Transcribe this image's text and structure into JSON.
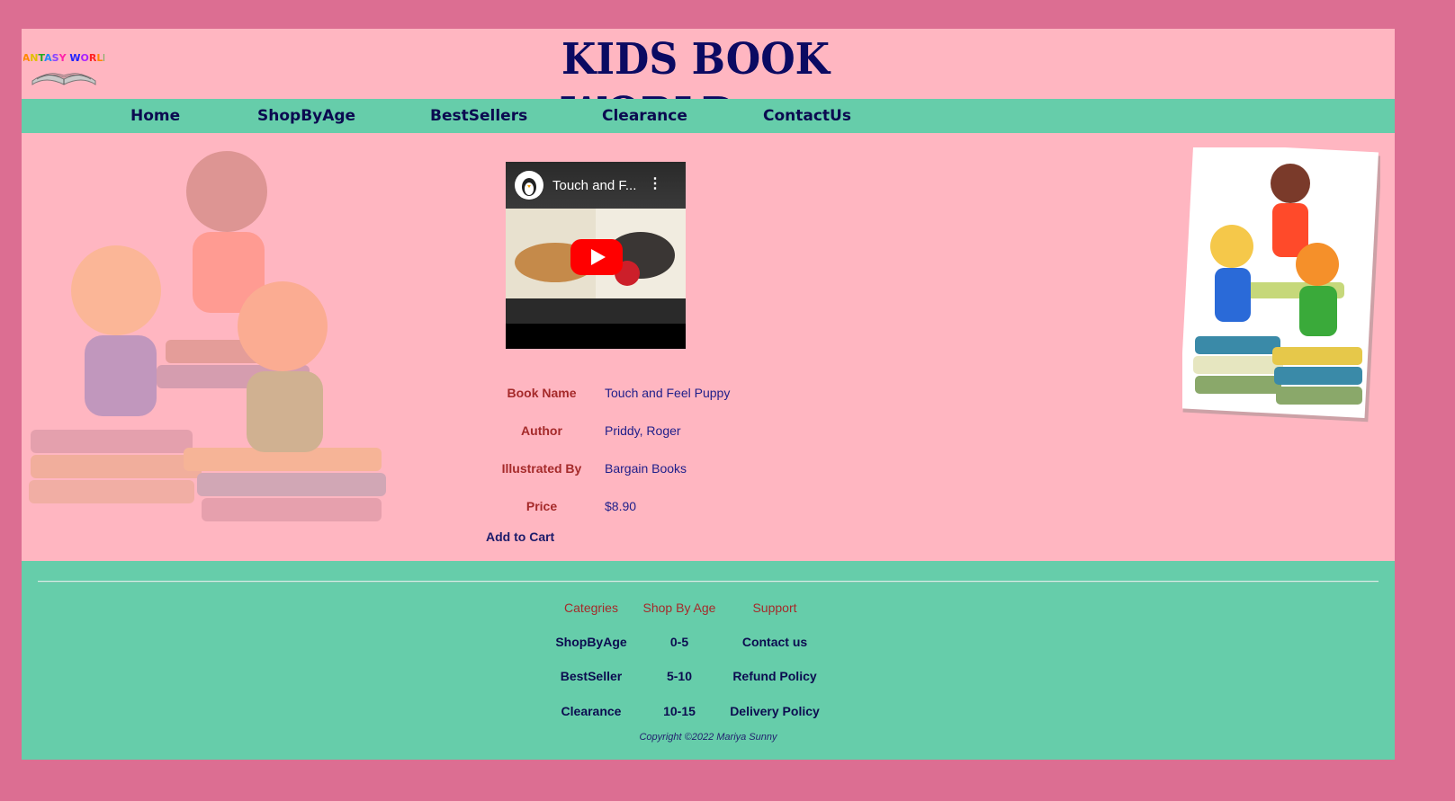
{
  "header": {
    "logo_text": "FANTASY WORLD",
    "title": "KIDS BOOK WORLD"
  },
  "nav": [
    {
      "label": "Home"
    },
    {
      "label": "ShopByAge"
    },
    {
      "label": "BestSellers"
    },
    {
      "label": "Clearance"
    },
    {
      "label": "ContactUs"
    }
  ],
  "video": {
    "title": "Touch and F...",
    "menu": "⋮"
  },
  "book": {
    "rows": [
      {
        "label": "Book Name",
        "value": "Touch and Feel Puppy"
      },
      {
        "label": "Author",
        "value": "Priddy, Roger"
      },
      {
        "label": "Illustrated By",
        "value": "Bargain Books"
      },
      {
        "label": "Price",
        "value": "$8.90"
      }
    ],
    "add_to_cart": "Add to Cart"
  },
  "footer": {
    "columns": [
      {
        "heading": "Categries",
        "links": [
          "ShopByAge",
          "BestSeller",
          "Clearance"
        ]
      },
      {
        "heading": "Shop By Age",
        "links": [
          "0-5",
          "5-10",
          "10-15"
        ]
      },
      {
        "heading": "Support",
        "links": [
          "Contact us",
          "Refund Policy",
          "Delivery Policy"
        ]
      }
    ],
    "copyright": "Copyright ©2022 Mariya Sunny"
  },
  "colors": {
    "outer_bg": "#dc6e92",
    "content_bg": "#ffb6c1",
    "bar_bg": "#66cdaa",
    "title_color": "#0b0a62",
    "label_color": "#a52a2a"
  }
}
